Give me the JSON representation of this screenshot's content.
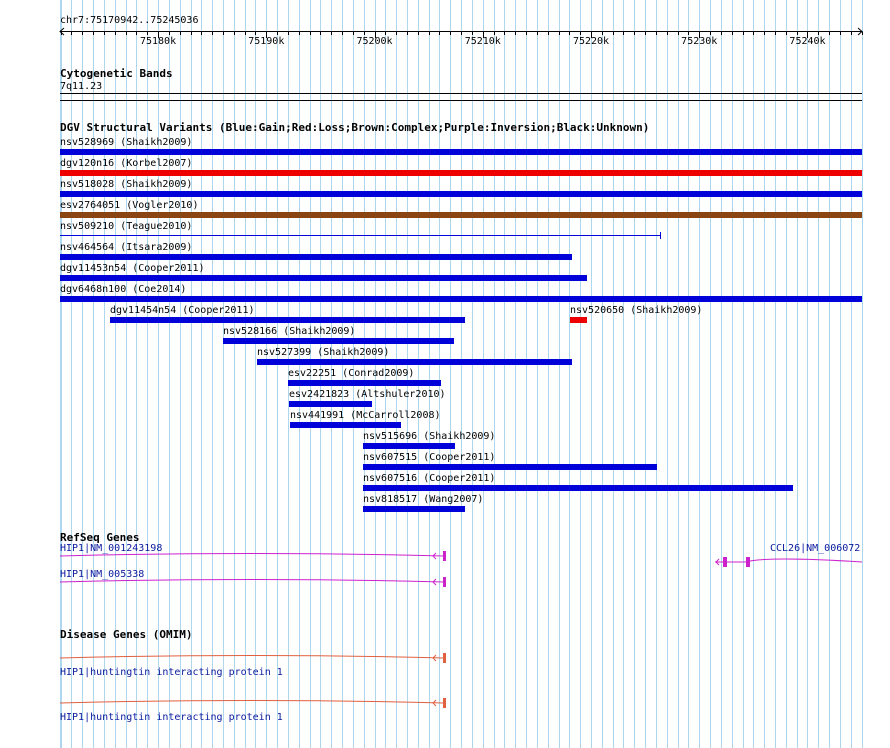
{
  "browser": {
    "position": "chr7:75170942..75245036",
    "range": [
      75170942,
      75245036
    ],
    "ticks": [
      {
        "pos": 75180000,
        "label": "75180k"
      },
      {
        "pos": 75190000,
        "label": "75190k"
      },
      {
        "pos": 75200000,
        "label": "75200k"
      },
      {
        "pos": 75210000,
        "label": "75210k"
      },
      {
        "pos": 75220000,
        "label": "75220k"
      },
      {
        "pos": 75230000,
        "label": "75230k"
      },
      {
        "pos": 75240000,
        "label": "75240k"
      }
    ]
  },
  "cytobands": {
    "title": "Cytogenetic Bands",
    "band": "7q11.23"
  },
  "dgv": {
    "title": "DGV Structural Variants (Blue:Gain;Red:Loss;Brown:Complex;Purple:Inversion;Black:Unknown)",
    "colors": {
      "gain": "#0000d8",
      "loss": "#ee0000",
      "complex": "#8b4513",
      "inversion": "#800080",
      "unknown": "#000000"
    },
    "variants": [
      {
        "label": "nsv528969 (Shaikh2009)",
        "type": "gain",
        "start": 75170942,
        "end": 75245036,
        "style": "bar"
      },
      {
        "label": "dgv120n16 (Korbel2007)",
        "type": "loss",
        "start": 75170942,
        "end": 75245036,
        "style": "bar"
      },
      {
        "label": "nsv518028 (Shaikh2009)",
        "type": "gain",
        "start": 75170942,
        "end": 75245036,
        "style": "bar"
      },
      {
        "label": "esv2764051 (Vogler2010)",
        "type": "complex",
        "start": 75170942,
        "end": 75245036,
        "style": "bar"
      },
      {
        "label": "nsv509210 (Teague2010)",
        "type": "gain",
        "start": 75170942,
        "end": 75226400,
        "style": "line"
      },
      {
        "label": "nsv464564 (Itsara2009)",
        "type": "gain",
        "start": 75170942,
        "end": 75218200,
        "style": "bar"
      },
      {
        "label": "dgv11453n54 (Cooper2011)",
        "type": "gain",
        "start": 75170942,
        "end": 75219600,
        "style": "bar"
      },
      {
        "label": "dgv6468n100 (Coe2014)",
        "type": "gain",
        "start": 75170942,
        "end": 75245036,
        "style": "bar"
      },
      {
        "label": "dgv11454n54 (Cooper2011)",
        "type": "gain",
        "start": 75175600,
        "end": 75208400,
        "style": "bar"
      },
      {
        "label": "nsv520650 (Shaikh2009)",
        "type": "loss",
        "start": 75218100,
        "end": 75219600,
        "style": "bar"
      },
      {
        "label": "nsv528166 (Shaikh2009)",
        "type": "gain",
        "start": 75186000,
        "end": 75207300,
        "style": "bar"
      },
      {
        "label": "nsv527399 (Shaikh2009)",
        "type": "gain",
        "start": 75189100,
        "end": 75218200,
        "style": "bar"
      },
      {
        "label": "esv22251 (Conrad2009)",
        "type": "gain",
        "start": 75192000,
        "end": 75206100,
        "style": "bar"
      },
      {
        "label": "esv2421823 (Altshuler2010)",
        "type": "gain",
        "start": 75192100,
        "end": 75199800,
        "style": "bar"
      },
      {
        "label": "nsv441991 (McCarroll2008)",
        "type": "gain",
        "start": 75192200,
        "end": 75202400,
        "style": "bar"
      },
      {
        "label": "nsv515696 (Shaikh2009)",
        "type": "gain",
        "start": 75198900,
        "end": 75207400,
        "style": "bar"
      },
      {
        "label": "nsv607515 (Cooper2011)",
        "type": "gain",
        "start": 75198900,
        "end": 75226100,
        "style": "bar"
      },
      {
        "label": "nsv607516 (Cooper2011)",
        "type": "gain",
        "start": 75198900,
        "end": 75238700,
        "style": "bar"
      },
      {
        "label": "nsv818517 (Wang2007)",
        "type": "gain",
        "start": 75198900,
        "end": 75208400,
        "style": "bar"
      }
    ]
  },
  "refseq": {
    "title": "RefSeq Genes",
    "color": "#cc22cc",
    "genes": [
      {
        "label": "HIP1|NM_001243198",
        "start": 75170942,
        "end": 75206400
      },
      {
        "label": "HIP1|NM_005338",
        "start": 75170942,
        "end": 75206400
      },
      {
        "label": "CCL26|NM_006072",
        "start": 75231500,
        "end": 75245036
      }
    ]
  },
  "disease": {
    "title": "Disease Genes (OMIM)",
    "color": "#e06040",
    "genes": [
      {
        "label": "HIP1|huntingtin interacting protein 1",
        "start": 75170942,
        "end": 75206400
      },
      {
        "label": "HIP1|huntingtin interacting protein 1",
        "start": 75170942,
        "end": 75206400
      }
    ]
  }
}
